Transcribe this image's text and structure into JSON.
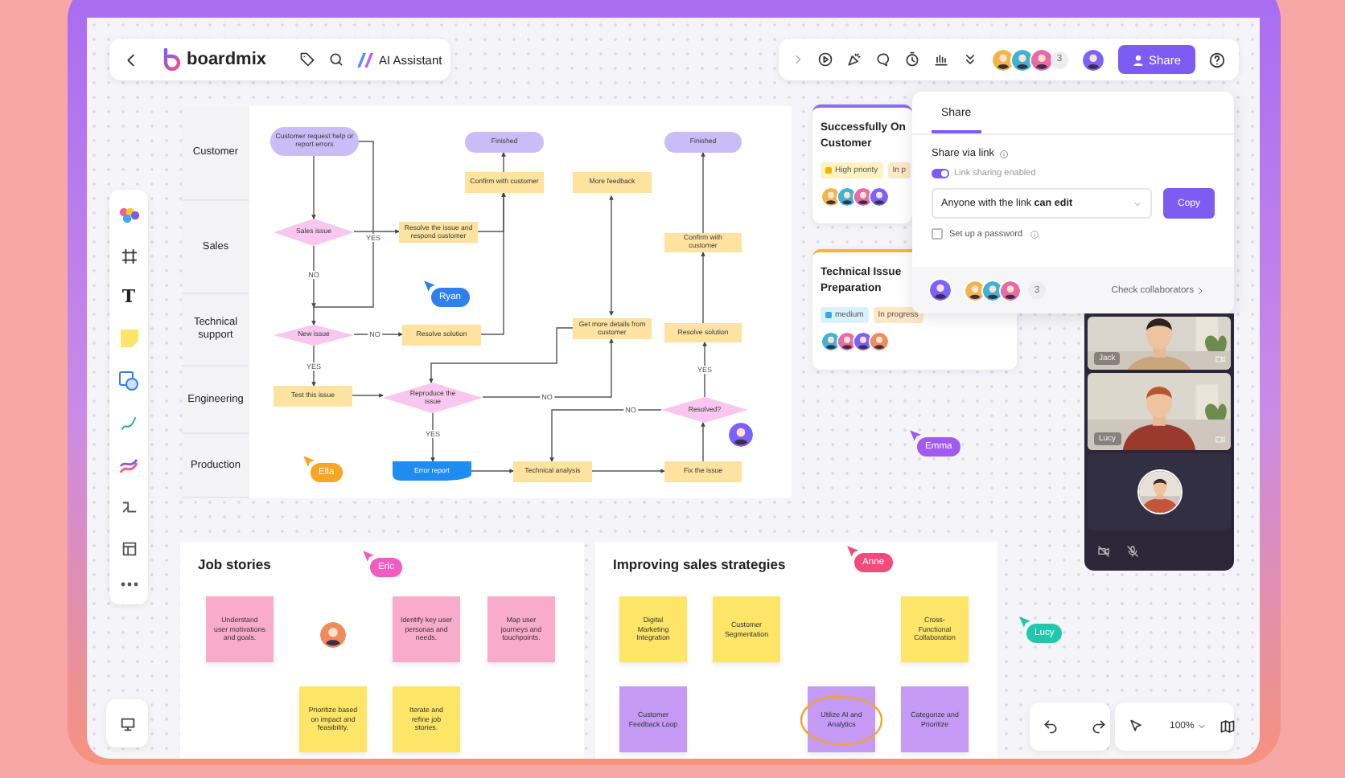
{
  "top_bar": {
    "app_name": "boardmix",
    "ai_button": "AI Assistant",
    "collaborator_count": "3",
    "share_button": "Share"
  },
  "tool_palette": {
    "text_tool": "T"
  },
  "flowchart": {
    "lanes": [
      "Customer",
      "Sales",
      "Technical support",
      "Engineering",
      "Production"
    ],
    "nodes": [
      {
        "kind": "terminal",
        "text": "Customer request help or report errors"
      },
      {
        "kind": "terminal",
        "text": "Finished"
      },
      {
        "kind": "process",
        "text": "Confirm with customer"
      },
      {
        "kind": "process",
        "text": "More feedback"
      },
      {
        "kind": "terminal",
        "text": "Finished"
      },
      {
        "kind": "decision",
        "text": "Sales issue"
      },
      {
        "kind": "process",
        "text": "Resolve the issue and respond customer"
      },
      {
        "kind": "process",
        "text": "Confirm with customer"
      },
      {
        "kind": "decision",
        "text": "New issue"
      },
      {
        "kind": "process",
        "text": "Resolve solution"
      },
      {
        "kind": "process",
        "text": "Get more details from customer"
      },
      {
        "kind": "process",
        "text": "Resolve solution"
      },
      {
        "kind": "process",
        "text": "Test this issue"
      },
      {
        "kind": "decision",
        "text": "Reproduce the issue"
      },
      {
        "kind": "decision",
        "text": "Resolved?"
      },
      {
        "kind": "document",
        "text": "Error report"
      },
      {
        "kind": "process",
        "text": "Technical analysis"
      },
      {
        "kind": "process",
        "text": "Fix the issue"
      }
    ],
    "edge_labels": [
      "YES",
      "NO",
      "NO",
      "YES",
      "NO",
      "YES",
      "NO",
      "YES"
    ]
  },
  "cards": [
    {
      "title_lines": [
        "Successfully On",
        "Customer"
      ],
      "color": "#8b6cf6",
      "tags": [
        {
          "kind": "priority",
          "text": "High priority",
          "color": "#fff2c2"
        },
        {
          "kind": "status",
          "text": "In p",
          "color": "#fde7c6"
        }
      ]
    },
    {
      "title_lines": [
        "Technical Issue",
        "Preparation"
      ],
      "color": "#f5b53d",
      "tags": [
        {
          "kind": "priority",
          "text": "medium",
          "color": "#d9f1fb"
        },
        {
          "kind": "status",
          "text": "In progress",
          "color": "#fde7c6"
        }
      ]
    }
  ],
  "share_panel": {
    "tab": {
      "label": "Share",
      "selected": true
    },
    "heading": "Share via link",
    "link_sharing": {
      "label": "Link sharing enabled",
      "on": true
    },
    "access": "Anyone with the link **can edit**",
    "copy_button": "Copy",
    "password": {
      "label": "Set up a password",
      "checked": false
    },
    "collaborator_count": "3",
    "collaborators_link": "Check collaborators"
  },
  "video_call": {
    "tiles": [
      {
        "kind": "video",
        "name": "Jack"
      },
      {
        "kind": "video",
        "name": "Lucy"
      },
      {
        "kind": "avatar"
      }
    ]
  },
  "boards": [
    {
      "title": "Job stories",
      "notes": [
        {
          "text": "Understand user motivations and goals.",
          "color": "#f9abcb",
          "circled": false
        },
        {
          "text": "Identify key user personas and needs.",
          "color": "#f9abcb",
          "circled": false
        },
        {
          "text": "Map user journeys and touchpoints.",
          "color": "#f9abcb",
          "circled": false
        },
        {
          "text": "Prioritize based on impact and feasibility.",
          "color": "#fde567",
          "circled": false
        },
        {
          "text": "Iterate and refine job stories.",
          "color": "#fde567",
          "circled": false
        }
      ]
    },
    {
      "title": "Improving sales strategies",
      "notes": [
        {
          "text": "Digital Marketing Integration",
          "color": "#fde567",
          "circled": false
        },
        {
          "text": "Customer Segmentation",
          "color": "#fde567",
          "circled": false
        },
        {
          "text": "Cross-Functional Collaboration",
          "color": "#fde567",
          "circled": false
        },
        {
          "text": "Customer Feedback Loop",
          "color": "#c49af5",
          "circled": false
        },
        {
          "text": "Utilize AI and Analytics",
          "color": "#c49af5",
          "circled": true
        },
        {
          "text": "Categorize and Prioritize",
          "color": "#c49af5",
          "circled": false
        }
      ]
    }
  ],
  "cursors": [
    {
      "name": "Ryan",
      "color": "#2f80ed"
    },
    {
      "name": "Ella",
      "color": "#f6a623"
    },
    {
      "name": "Emma",
      "color": "#a259f0"
    },
    {
      "name": "Eric",
      "color": "#f25cc0"
    },
    {
      "name": "Anne",
      "color": "#f24a7a"
    },
    {
      "name": "Lucy",
      "color": "#22c7a9"
    }
  ],
  "zoom": "100%"
}
